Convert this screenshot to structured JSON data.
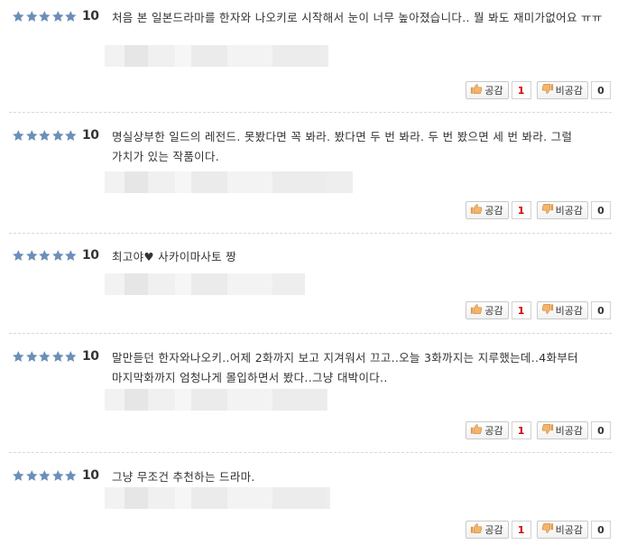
{
  "score_value": "10",
  "labels": {
    "like": "공감",
    "dislike": "비공감"
  },
  "reviews": [
    {
      "rating": 5,
      "text": "처음 본 일본드라마를 한자와 나오키로 시작해서 눈이 너무 높아졌습니다.. 뭘 봐도 재미가없어요 ㅠㅠ",
      "likes": "1",
      "dislikes": "0"
    },
    {
      "rating": 5,
      "text": "명실상부한 일드의 레전드. 못봤다면 꼭 봐라. 봤다면 두 번 봐라. 두 번 봤으면 세 번 봐라. 그럴 가치가 있는 작품이다.",
      "likes": "1",
      "dislikes": "0"
    },
    {
      "rating": 5,
      "text": "최고야♥ 사카이마사토 짱",
      "likes": "1",
      "dislikes": "0"
    },
    {
      "rating": 5,
      "text": "말만듣던 한자와나오키..어제 2화까지 보고 지겨워서 끄고..오늘 3화까지는 지루했는데..4화부터 마지막화까지 엄청나게 몰입하면서 봤다..그냥 대박이다..",
      "likes": "1",
      "dislikes": "0"
    },
    {
      "rating": 5,
      "text": "그냥 무조건 추천하는 드라마.",
      "likes": "1",
      "dislikes": "0"
    }
  ],
  "colors": {
    "star": "#6b8fb8",
    "like_count": "#d20000",
    "divider": "#d9d9d9"
  }
}
